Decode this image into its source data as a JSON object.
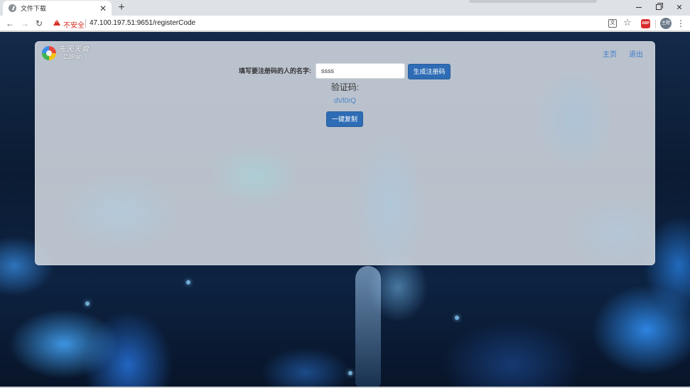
{
  "browser": {
    "tab": {
      "title": "文件下载",
      "favicon": "app-favicon-icon",
      "close_glyph": "✕"
    },
    "new_tab_glyph": "+",
    "window_controls": {
      "minimize": "minimize-icon",
      "maximize": "restore-icon",
      "close_glyph": "✕"
    },
    "address_bar": {
      "security_label": "不安全",
      "url": "47.100.197.51:9651/registerCode"
    },
    "toolbar_icons": {
      "back": "←",
      "forward": "→",
      "reload": "↻",
      "translate": "文",
      "star": "☆",
      "adblock": "ABP",
      "avatar": "主题",
      "menu": "⋮"
    }
  },
  "site": {
    "logo": {
      "title": "先天天启",
      "subtitle": "CJPan"
    },
    "nav": {
      "home": "主页",
      "logout": "退出"
    }
  },
  "register": {
    "label": "填写要注册码的人的名字:",
    "name_value": "ssss",
    "generate_button": "生成注册码",
    "code_heading": "验证码:",
    "code_value": "dVl0rQ",
    "copy_button": "一键复制"
  },
  "colors": {
    "primary_button": "#2e6cb5",
    "link": "#3d7cc9",
    "insecure_red": "#d93025"
  }
}
